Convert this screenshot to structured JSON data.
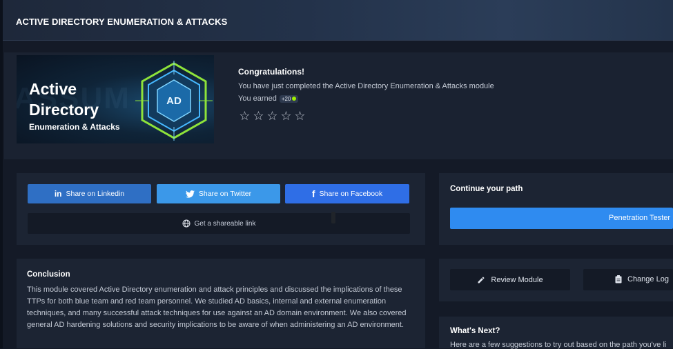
{
  "header": {
    "title": "ACTIVE DIRECTORY ENUMERATION & ATTACKS"
  },
  "hero": {
    "image": {
      "line1": "Active",
      "line2": "Directory",
      "line3": "Enumeration & Attacks",
      "badge": "AD"
    },
    "congrats": "Congratulations!",
    "completed": "You have just completed the Active Directory Enumeration & Attacks module",
    "earned_label": "You earned",
    "earned_value": "+20",
    "stars": [
      "☆",
      "☆",
      "☆",
      "☆",
      "☆"
    ]
  },
  "share": {
    "linkedin": "Share on Linkedin",
    "twitter": "Share on Twitter",
    "facebook": "Share on Facebook",
    "link": "Get a shareable link"
  },
  "conclusion": {
    "title": "Conclusion",
    "text": "This module covered Active Directory enumeration and attack principles and discussed the implications of these TTPs for both blue team and red team personnel. We studied AD basics, internal and external enumeration techniques, and many successful attack techniques for use against an AD domain environment. We also covered general AD hardening solutions and security implications to be aware of when administering an AD environment."
  },
  "path": {
    "title": "Continue your path",
    "button": "Penetration Tester"
  },
  "actions": {
    "review": "Review Module",
    "changelog": "Change Log"
  },
  "next": {
    "title": "What's Next?",
    "text": "Here are a few suggestions to try out based on the path you've li"
  },
  "colors": {
    "accent": "#2f8bf0",
    "linkedin": "#2f6fc4",
    "twitter": "#3b98e9",
    "facebook": "#2f6ee6",
    "badge_green": "#9fef00"
  }
}
